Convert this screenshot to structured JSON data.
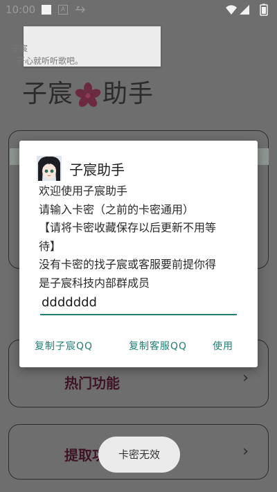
{
  "status_bar": {
    "time": "10:00"
  },
  "popup": {
    "line1": "子宸",
    "line2": "开心就听听歌吧。"
  },
  "app": {
    "title_part1": "子宸",
    "title_part2": "助手",
    "cards": [
      {
        "label": "热门功能"
      },
      {
        "label": "提取功能"
      }
    ]
  },
  "dialog": {
    "title": "子宸助手",
    "message_lines": [
      "欢迎使用子宸助手",
      "请输入卡密（之前的卡密通用）",
      "【请将卡密收藏保存以后更新不用等",
      "待】",
      "没有卡密的找子宸或客服要前提你得",
      "是子宸科技内部群成员"
    ],
    "input_value": "ddddddd",
    "buttons": {
      "copy_zichen": "复制子宸QQ",
      "copy_service": "复制客服QQ",
      "use": "使用"
    }
  },
  "toast": {
    "text": "卡密无效"
  },
  "colors": {
    "accent": "#1e7e74",
    "card_label": "#3f1326",
    "overlay": "#6e6e6e"
  },
  "icons": [
    "notification-icon",
    "a-icon",
    "usb-icon",
    "wifi-icon",
    "signal-icon",
    "battery-icon",
    "sakura-flower-icon",
    "chevron-right-icon",
    "avatar"
  ]
}
